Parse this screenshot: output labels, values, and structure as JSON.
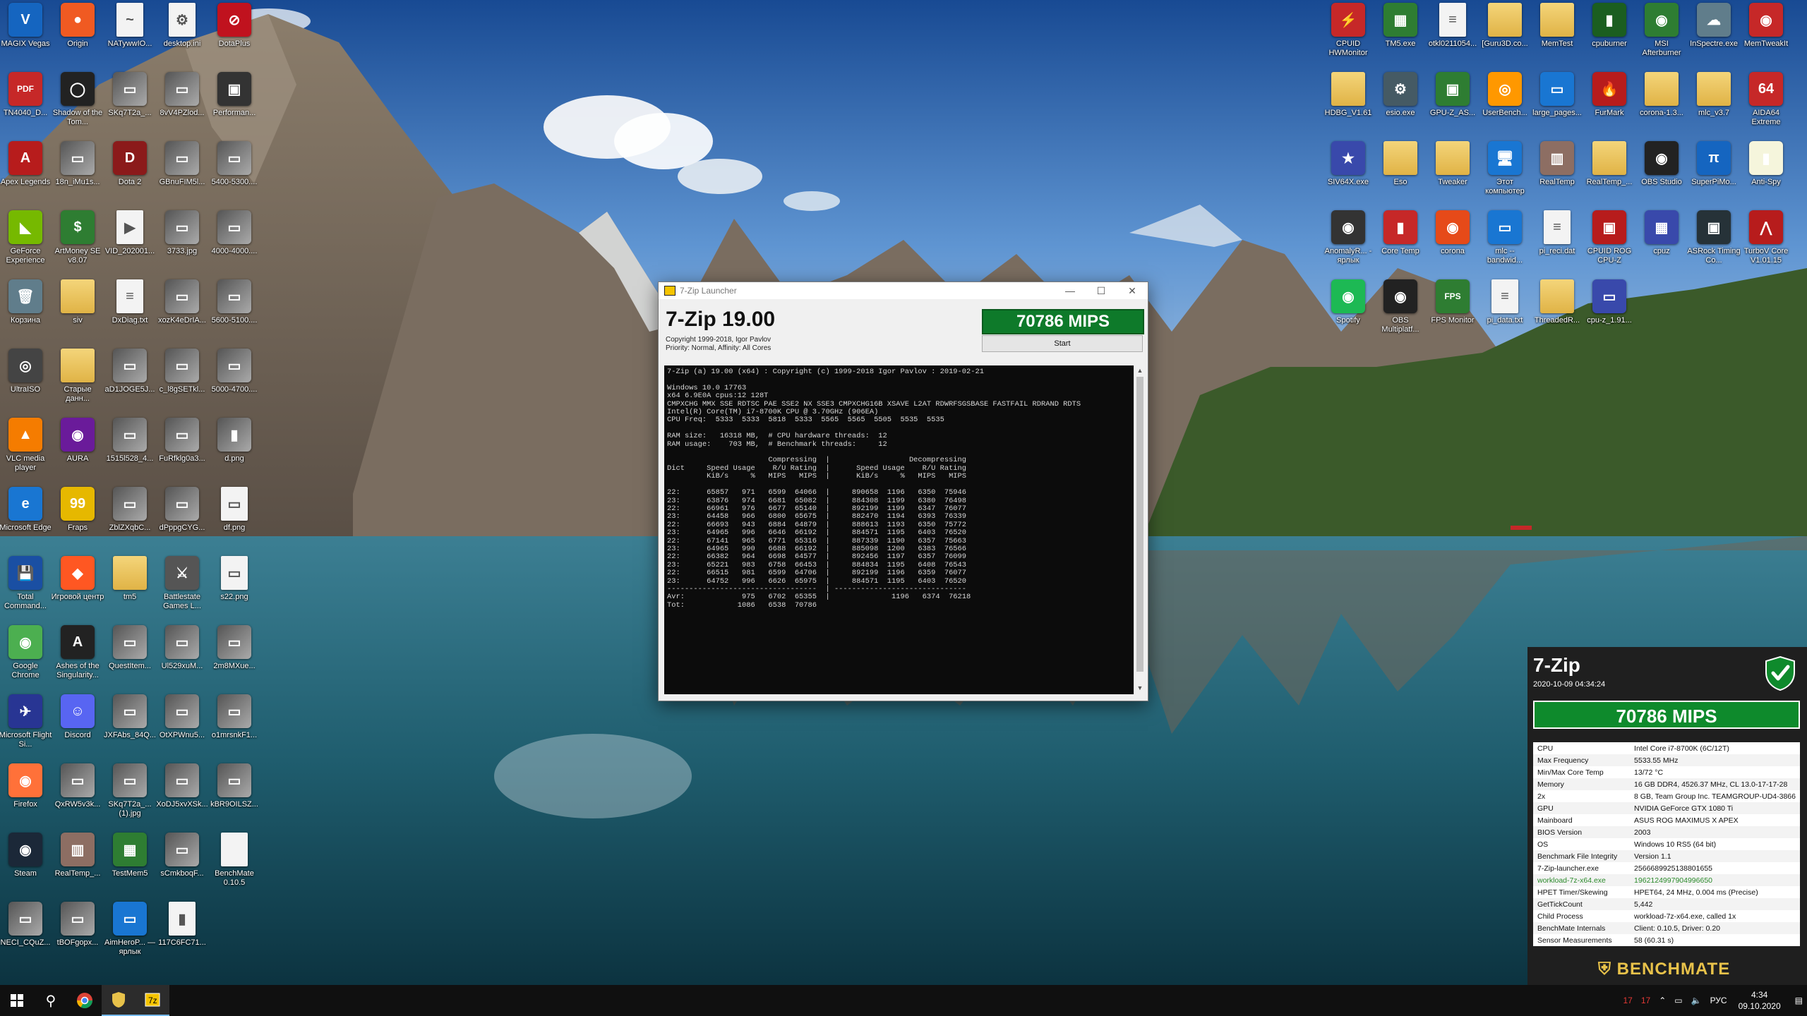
{
  "desktop": {
    "left_icons": [
      {
        "label": "MAGIX Vegas",
        "glyph": "V",
        "color": "#1565c0"
      },
      {
        "label": "Origin",
        "glyph": "●",
        "color": "#f05a22"
      },
      {
        "label": "NATywwIO...",
        "glyph": "~",
        "color": "file"
      },
      {
        "label": "desktop.ini",
        "glyph": "⚙",
        "color": "file"
      },
      {
        "label": "DotaPlus",
        "glyph": "⊘",
        "color": "#c0121e"
      },
      {
        "label": "TN4040_D...",
        "glyph": "PDF",
        "color": "#c62828"
      },
      {
        "label": "Shadow of the Tom...",
        "glyph": "◯",
        "color": "#222"
      },
      {
        "label": "SKq7T2a_...",
        "glyph": "▭",
        "color": "img"
      },
      {
        "label": "8vV4PZlod...",
        "glyph": "▭",
        "color": "img"
      },
      {
        "label": "Performan...",
        "glyph": "▣",
        "color": "#333"
      },
      {
        "label": "Apex Legends",
        "glyph": "A",
        "color": "#b71c1c"
      },
      {
        "label": "18n_iMu1s...",
        "glyph": "▭",
        "color": "img"
      },
      {
        "label": "Dota 2",
        "glyph": "D",
        "color": "#8b1a1a"
      },
      {
        "label": "GBnuFIM5l...",
        "glyph": "▭",
        "color": "img"
      },
      {
        "label": "5400-5300....",
        "glyph": "▭",
        "color": "img"
      },
      {
        "label": "GeForce Experience",
        "glyph": "◣",
        "color": "#76b900"
      },
      {
        "label": "ArtMoney SE v8.07",
        "glyph": "$",
        "color": "#2e7d32"
      },
      {
        "label": "VID_202001...",
        "glyph": "▶",
        "color": "file"
      },
      {
        "label": "3733.jpg",
        "glyph": "▭",
        "color": "img"
      },
      {
        "label": "4000-4000....",
        "glyph": "▭",
        "color": "img"
      },
      {
        "label": "Корзина",
        "glyph": "🗑",
        "color": "#607d8b"
      },
      {
        "label": "siv",
        "glyph": "",
        "color": "folder"
      },
      {
        "label": "DxDiag.txt",
        "glyph": "≡",
        "color": "file"
      },
      {
        "label": "xozK4eDrIA...",
        "glyph": "▭",
        "color": "img"
      },
      {
        "label": "5600-5100....",
        "glyph": "▭",
        "color": "img"
      },
      {
        "label": "UltraISO",
        "glyph": "◎",
        "color": "#444"
      },
      {
        "label": "Старые данн...",
        "glyph": "",
        "color": "folder"
      },
      {
        "label": "aD1JOGE5J...",
        "glyph": "▭",
        "color": "img"
      },
      {
        "label": "c_l8gSETkl...",
        "glyph": "▭",
        "color": "img"
      },
      {
        "label": "5000-4700....",
        "glyph": "▭",
        "color": "img"
      },
      {
        "label": "VLC media player",
        "glyph": "▲",
        "color": "#f57c00"
      },
      {
        "label": "AURA",
        "glyph": "◉",
        "color": "#6a1b9a"
      },
      {
        "label": "1515l528_4...",
        "glyph": "▭",
        "color": "img"
      },
      {
        "label": "FuRfklg0a3...",
        "glyph": "▭",
        "color": "img"
      },
      {
        "label": "d.png",
        "glyph": "▮",
        "color": "img"
      },
      {
        "label": "Microsoft Edge",
        "glyph": "e",
        "color": "#1976d2"
      },
      {
        "label": "Fraps",
        "glyph": "99",
        "color": "#e6b800"
      },
      {
        "label": "ZblZXqbC...",
        "glyph": "▭",
        "color": "img"
      },
      {
        "label": "dPppgCYG...",
        "glyph": "▭",
        "color": "img"
      },
      {
        "label": "df.png",
        "glyph": "▭",
        "color": "file"
      },
      {
        "label": "Total Command...",
        "glyph": "💾",
        "color": "#1a4fa3"
      },
      {
        "label": "Игровой центр",
        "glyph": "◆",
        "color": "#ff5722"
      },
      {
        "label": "tm5",
        "glyph": "",
        "color": "folder"
      },
      {
        "label": "Battlestate Games L...",
        "glyph": "⚔",
        "color": "#555"
      },
      {
        "label": "s22.png",
        "glyph": "▭",
        "color": "file"
      },
      {
        "label": "Google Chrome",
        "glyph": "◉",
        "color": "#4caf50"
      },
      {
        "label": "Ashes of the Singularity...",
        "glyph": "A",
        "color": "#222"
      },
      {
        "label": "QuestItem...",
        "glyph": "▭",
        "color": "img"
      },
      {
        "label": "Ul529xuM...",
        "glyph": "▭",
        "color": "img"
      },
      {
        "label": "2m8MXue...",
        "glyph": "▭",
        "color": "img"
      },
      {
        "label": "Microsoft Flight Si...",
        "glyph": "✈",
        "color": "#283593"
      },
      {
        "label": "Discord",
        "glyph": "☺",
        "color": "#5865f2"
      },
      {
        "label": "JXFAbs_84Q...",
        "glyph": "▭",
        "color": "img"
      },
      {
        "label": "OtXPWnu5...",
        "glyph": "▭",
        "color": "img"
      },
      {
        "label": "o1mrsnkF1...",
        "glyph": "▭",
        "color": "img"
      },
      {
        "label": "Firefox",
        "glyph": "◉",
        "color": "#ff7139"
      },
      {
        "label": "QxRW5v3k...",
        "glyph": "▭",
        "color": "img"
      },
      {
        "label": "SKq7T2a_... (1).jpg",
        "glyph": "▭",
        "color": "img"
      },
      {
        "label": "XoDJ5xvXSk...",
        "glyph": "▭",
        "color": "img"
      },
      {
        "label": "kBR9OILSZ...",
        "glyph": "▭",
        "color": "img"
      },
      {
        "label": "Steam",
        "glyph": "◉",
        "color": "#1b2838"
      },
      {
        "label": "RealTemp_...",
        "glyph": "▥",
        "color": "#8d6e63"
      },
      {
        "label": "TestMem5",
        "glyph": "▦",
        "color": "#2e7d32"
      },
      {
        "label": "sCmkboqF...",
        "glyph": "▭",
        "color": "img"
      },
      {
        "label": "BenchMate 0.10.5",
        "glyph": "",
        "color": "file"
      },
      {
        "label": "NECI_CQuZ...",
        "glyph": "▭",
        "color": "img"
      },
      {
        "label": "tBOFgopx...",
        "glyph": "▭",
        "color": "img"
      },
      {
        "label": "AimHeroP... — ярлык",
        "glyph": "▭",
        "color": "#1976d2"
      },
      {
        "label": "117C6FC71...",
        "glyph": "▮",
        "color": "file"
      }
    ],
    "right_icons": [
      {
        "label": "CPUID HWMonitor",
        "glyph": "⚡",
        "color": "#c62828"
      },
      {
        "label": "TM5.exe",
        "glyph": "▦",
        "color": "#2e7d32"
      },
      {
        "label": "otkl0211054...",
        "glyph": "≡",
        "color": "file"
      },
      {
        "label": "[Guru3D.co...",
        "glyph": "",
        "color": "folder"
      },
      {
        "label": "MemTest",
        "glyph": "",
        "color": "folder"
      },
      {
        "label": "cpuburner",
        "glyph": "▮",
        "color": "#1b5e20"
      },
      {
        "label": "MSI Afterburner",
        "glyph": "◉",
        "color": "#2e7d32"
      },
      {
        "label": "InSpectre.exe",
        "glyph": "☁",
        "color": "#607d8b"
      },
      {
        "label": "MemTweakIt",
        "glyph": "◉",
        "color": "#c62828"
      },
      {
        "label": "HDBG_V1.61",
        "glyph": "",
        "color": "folder"
      },
      {
        "label": "esio.exe",
        "glyph": "⚙",
        "color": "#455a64"
      },
      {
        "label": "GPU-Z_AS...",
        "glyph": "▣",
        "color": "#2e7d32"
      },
      {
        "label": "UserBench...",
        "glyph": "◎",
        "color": "#ff9800"
      },
      {
        "label": "large_pages...",
        "glyph": "▭",
        "color": "#1976d2"
      },
      {
        "label": "FurMark",
        "glyph": "🔥",
        "color": "#b71c1c"
      },
      {
        "label": "corona-1.3...",
        "glyph": "",
        "color": "folder"
      },
      {
        "label": "mlc_v3.7",
        "glyph": "",
        "color": "folder"
      },
      {
        "label": "AIDA64 Extreme",
        "glyph": "64",
        "color": "#c62828"
      },
      {
        "label": "SIV64X.exe",
        "glyph": "★",
        "color": "#3949ab"
      },
      {
        "label": "Eso",
        "glyph": "",
        "color": "folder"
      },
      {
        "label": "Tweaker",
        "glyph": "",
        "color": "folder"
      },
      {
        "label": "Этот компьютер",
        "glyph": "🖥",
        "color": "#1976d2"
      },
      {
        "label": "RealTemp",
        "glyph": "▥",
        "color": "#8d6e63"
      },
      {
        "label": "RealTemp_...",
        "glyph": "",
        "color": "folder"
      },
      {
        "label": "OBS Studio",
        "glyph": "◉",
        "color": "#222"
      },
      {
        "label": "SuperPiMo...",
        "glyph": "π",
        "color": "#1565c0"
      },
      {
        "label": "Anti-Spy",
        "glyph": "▮",
        "color": "#f5f5dc"
      },
      {
        "label": "AnomalyR... - ярлык",
        "glyph": "◉",
        "color": "#333"
      },
      {
        "label": "Core Temp",
        "glyph": "▮",
        "color": "#c62828"
      },
      {
        "label": "corona",
        "glyph": "◉",
        "color": "#e64a19"
      },
      {
        "label": "mlc --bandwid...",
        "glyph": "▭",
        "color": "#1976d2"
      },
      {
        "label": "pi_reci.dat",
        "glyph": "≡",
        "color": "file"
      },
      {
        "label": "CPUID ROG CPU-Z",
        "glyph": "▣",
        "color": "#b71c1c"
      },
      {
        "label": "cpuz",
        "glyph": "▦",
        "color": "#3949ab"
      },
      {
        "label": "ASRock Timing Co...",
        "glyph": "▣",
        "color": "#263238"
      },
      {
        "label": "TurboV Core V1.01.15",
        "glyph": "⋀",
        "color": "#b71c1c"
      },
      {
        "label": "Spotify",
        "glyph": "◉",
        "color": "#1db954"
      },
      {
        "label": "OBS Multiplatf...",
        "glyph": "◉",
        "color": "#222"
      },
      {
        "label": "FPS Monitor",
        "glyph": "FPS",
        "color": "#2e7d32"
      },
      {
        "label": "pi_data.txt",
        "glyph": "≡",
        "color": "file"
      },
      {
        "label": "ThreadedR...",
        "glyph": "",
        "color": "folder"
      },
      {
        "label": "cpu-z_1.91...",
        "glyph": "▭",
        "color": "#3949ab"
      }
    ]
  },
  "zip_window": {
    "title": "7-Zip Launcher",
    "controls": [
      "—",
      "☐",
      "✕"
    ],
    "app_title": "7-Zip 19.00",
    "copyright": "Copyright 1999-2018, Igor Pavlov",
    "priority": "Priority: Normal, Affinity: All Cores",
    "score": "70786 MIPS",
    "start_label": "Start",
    "console": [
      "7-Zip (a) 19.00 (x64) : Copyright (c) 1999-2018 Igor Pavlov : 2019-02-21",
      "",
      "Windows 10.0 17763",
      "x64 6.9E0A cpus:12 128T",
      "CMPXCHG MMX SSE RDTSC PAE SSE2 NX SSE3 CMPXCHG16B XSAVE L2AT RDWRFSGSBASE FASTFAIL RDRAND RDTS",
      "Intel(R) Core(TM) i7-8700K CPU @ 3.70GHz (906EA)",
      "CPU Freq:  5333  5333  5818  5333  5565  5565  5505  5535  5535",
      "",
      "RAM size:   16318 MB,  # CPU hardware threads:  12",
      "RAM usage:    703 MB,  # Benchmark threads:     12",
      "",
      "                       Compressing  |                  Decompressing",
      "Dict     Speed Usage    R/U Rating  |      Speed Usage    R/U Rating",
      "         KiB/s     %   MIPS   MIPS  |      KiB/s     %   MIPS   MIPS",
      "",
      "22:      65857   971   6599  64066  |     890658  1196   6350  75946",
      "23:      63876   974   6681  65082  |     884308  1199   6380  76498",
      "22:      66961   976   6677  65140  |     892199  1199   6347  76077",
      "23:      64458   966   6800  65675  |     882470  1194   6393  76339",
      "22:      66693   943   6884  64879  |     888613  1193   6350  75772",
      "23:      64965   996   6646  66192  |     884571  1195   6403  76520",
      "22:      67141   965   6771  65316  |     887339  1190   6357  75663",
      "23:      64965   990   6688  66192  |     885098  1200   6383  76566",
      "22:      66382   964   6698  64577  |     892456  1197   6357  76099",
      "23:      65221   983   6758  66453  |     884834  1195   6408  76543",
      "22:      66515   981   6599  64706  |     892199  1196   6359  76077",
      "23:      64752   996   6626  65975  |     884571  1195   6403  76520",
      "----------------------------------  | ------------------------------",
      "Avr:             975   6702  65355  |              1196   6374  76218",
      "Tot:            1086   6538  70786"
    ]
  },
  "benchmate": {
    "name": "7-Zip",
    "datetime": "2020-10-09 04:34:24",
    "score": "70786 MIPS",
    "rows": [
      [
        "CPU",
        "Intel Core i7-8700K (6C/12T)"
      ],
      [
        "Max Frequency",
        "5533.55 MHz"
      ],
      [
        "Min/Max Core Temp",
        "13/72 °C"
      ],
      [
        "Memory",
        "16 GB DDR4, 4526.37 MHz, CL 13.0-17-17-28"
      ],
      [
        "2x",
        "8 GB, Team Group Inc. TEAMGROUP-UD4-3866"
      ],
      [
        "GPU",
        "NVIDIA GeForce GTX 1080 Ti"
      ],
      [
        "Mainboard",
        "ASUS ROG MAXIMUS X APEX"
      ],
      [
        "BIOS Version",
        "2003"
      ],
      [
        "OS",
        "Windows 10 RS5 (64 bit)"
      ],
      [
        "Benchmark File Integrity",
        "Version 1.1"
      ],
      [
        "7-Zip-launcher.exe",
        "2566689925138801655"
      ],
      [
        "workload-7z-x64.exe",
        "1962124997904996650"
      ],
      [
        "HPET Timer/Skewing",
        "HPET64, 24 MHz, 0.004 ms (Precise)"
      ],
      [
        "GetTickCount",
        "5,442"
      ],
      [
        "Child Process",
        "workload-7z-x64.exe, called 1x"
      ],
      [
        "BenchMate Internals",
        "Client: 0.10.5, Driver: 0.20"
      ],
      [
        "Sensor Measurements",
        "58 (60.31 s)"
      ]
    ],
    "green_row_index": 11,
    "brand": "BENCHMATE",
    "accent": "#0e8a2c"
  },
  "taskbar": {
    "start_icon": "windows-icon",
    "search_icon": "⚲",
    "pinned": [
      "chrome-icon",
      "benchmate-icon",
      "7zip-icon"
    ],
    "tray_temp1": "17",
    "tray_temp2": "17",
    "language": "РУС",
    "time": "4:34",
    "date": "09.10.2020"
  }
}
